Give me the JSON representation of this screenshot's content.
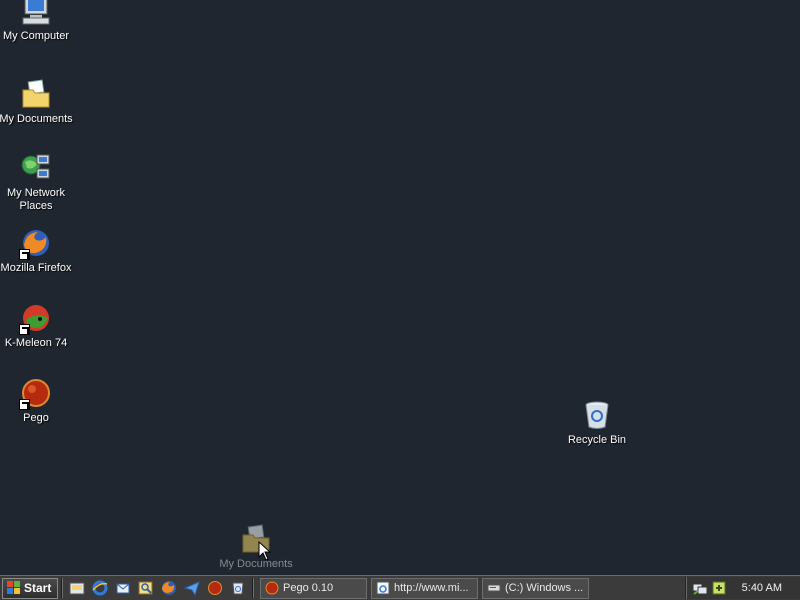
{
  "desktop": {
    "icons": [
      {
        "label": "My Computer",
        "icon": "my-computer-icon"
      },
      {
        "label": "My Documents",
        "icon": "my-documents-icon"
      },
      {
        "label": "My Network Places",
        "icon": "network-places-icon"
      },
      {
        "label": "Mozilla Firefox",
        "icon": "firefox-icon"
      },
      {
        "label": "K-Meleon 74",
        "icon": "k-meleon-icon"
      },
      {
        "label": "Pego",
        "icon": "pego-icon"
      },
      {
        "label": "Recycle Bin",
        "icon": "recycle-bin-icon"
      }
    ],
    "drag_ghost": {
      "label": "My Documents",
      "icon": "my-documents-icon"
    }
  },
  "taskbar": {
    "start_label": "Start",
    "quick_launch": [
      "show-desktop-icon",
      "internet-explorer-icon",
      "outlook-icon",
      "search-icon",
      "firefox-icon",
      "send-icon",
      "pego-icon",
      "recycle-icon"
    ],
    "tasks": [
      {
        "label": "Pego 0.10",
        "icon": "pego-icon"
      },
      {
        "label": "http://www.mi...",
        "icon": "browser-page-icon"
      },
      {
        "label": "(C:) Windows ...",
        "icon": "drive-icon"
      }
    ],
    "tray_icons": [
      "network-tray-icon",
      "app-tray-icon"
    ],
    "clock": "5:40 AM"
  },
  "colors": {
    "desktop_bg": "#202630",
    "taskbar_bg": "#3b3b3b"
  }
}
